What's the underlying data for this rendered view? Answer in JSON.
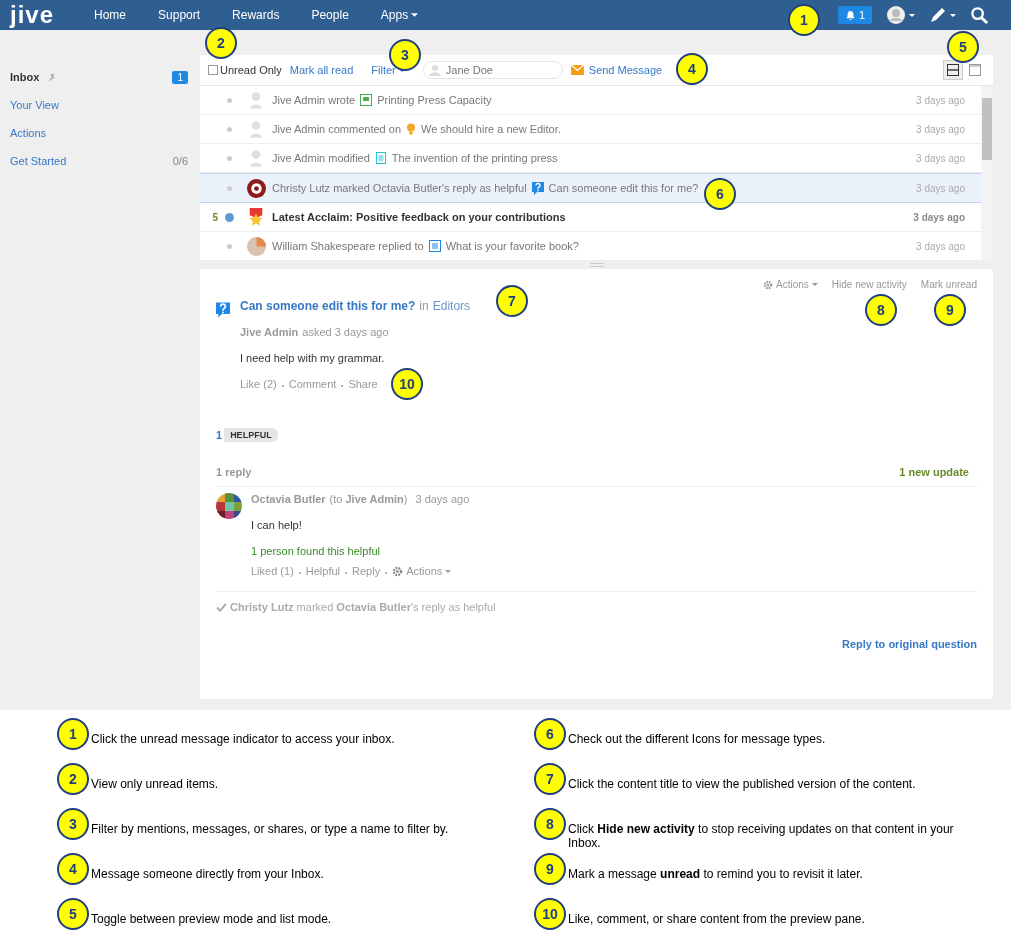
{
  "nav": {
    "logo": "jive",
    "items": [
      "Home",
      "Support",
      "Rewards",
      "People",
      "Apps"
    ],
    "notification_count": "1"
  },
  "sidebar": {
    "items": [
      {
        "label": "Inbox",
        "selected": true,
        "pinned": true,
        "badge": "1"
      },
      {
        "label": "Your View",
        "selected": false
      },
      {
        "label": "Actions",
        "selected": false
      },
      {
        "label": "Get Started",
        "selected": false,
        "count": "0/6"
      }
    ]
  },
  "toolbar": {
    "unread_only": {
      "label": "Unread Only",
      "checked": false
    },
    "mark_all_read": "Mark all read",
    "filter": "Filter",
    "search": {
      "placeholder": "Jane Doe"
    },
    "send_message": "Send Message",
    "view_modes": [
      {
        "kind": "preview",
        "selected": true
      },
      {
        "kind": "list",
        "selected": false
      }
    ]
  },
  "messages": [
    {
      "unread": false,
      "selected": false,
      "avatar": {
        "kind": "silhouette"
      },
      "actor": "Jive Admin wrote",
      "content": {
        "kind": "blog",
        "title": "Printing Press Capacity"
      },
      "time": "3 days ago"
    },
    {
      "unread": false,
      "selected": false,
      "avatar": {
        "kind": "silhouette"
      },
      "actor": "Jive Admin commented on",
      "content": {
        "kind": "idea",
        "title": "We should hire a new Editor."
      },
      "time": "3 days ago"
    },
    {
      "unread": false,
      "selected": false,
      "avatar": {
        "kind": "silhouette"
      },
      "actor": "Jive Admin modified",
      "content": {
        "kind": "document",
        "title": "The invention of the printing press"
      },
      "time": "3 days ago"
    },
    {
      "unread": false,
      "selected": true,
      "avatar": {
        "kind": "target"
      },
      "actor": "Christy Lutz marked Octavia Butler's reply as helpful",
      "content": {
        "kind": "question",
        "title": "Can someone edit this for me?"
      },
      "time": "3 days ago"
    },
    {
      "unread": true,
      "selected": false,
      "count": "5",
      "avatar": {
        "kind": "award"
      },
      "actor": "Latest Acclaim: Positive feedback on your contributions",
      "time": "3 days ago"
    },
    {
      "unread": false,
      "selected": false,
      "avatar": {
        "kind": "photo"
      },
      "actor": "William Shakespeare replied to",
      "content": {
        "kind": "discussion",
        "title": "What is your favorite book?"
      },
      "time": "3 days ago"
    }
  ],
  "preview": {
    "actions": "Actions",
    "hide_new_activity": "Hide new activity",
    "mark_unread": "Mark unread",
    "title": "Can someone edit this for me?",
    "in": "in",
    "place": "Editors",
    "author": "Jive Admin",
    "asked": "asked 3 days ago",
    "body": "I need help with my grammar.",
    "links": [
      "Like (2)",
      "Comment",
      "Share"
    ],
    "helpful": {
      "count": "1",
      "label": "HELPFUL"
    },
    "replies_label": "1 reply",
    "new_update": "1 new update",
    "reply": {
      "author": "Octavia Butler",
      "to": "(to **Jive Admin**)",
      "time": "3 days ago",
      "body": "I can help!",
      "helpful_note": "1 person found this helpful",
      "links": [
        "Liked (1)",
        "Helpful",
        "Reply"
      ],
      "actions": "Actions"
    },
    "marked": "**Christy Lutz** marked **Octavia Butler**'s reply as helpful",
    "reply_original": "Reply to original question"
  },
  "callouts": [
    "1",
    "2",
    "3",
    "4",
    "5",
    "6",
    "7",
    "8",
    "9",
    "10"
  ],
  "annotations": [
    {
      "number": "1",
      "text": "Click the unread message indicator to access your inbox."
    },
    {
      "number": "2",
      "text": "View only unread items."
    },
    {
      "number": "3",
      "text": "Filter by mentions, messages, or shares, or type a name to filter by."
    },
    {
      "number": "4",
      "text": "Message someone directly from your Inbox."
    },
    {
      "number": "5",
      "text": "Toggle between preview mode and list mode."
    },
    {
      "number": "6",
      "text": "Check out the different Icons for message types."
    },
    {
      "number": "7",
      "text": "Click the content title to view the published version of the content."
    },
    {
      "number": "8",
      "text": "Click **Hide new activity** to stop receiving updates on that content in your Inbox."
    },
    {
      "number": "9",
      "text": "Mark a message **unread** to remind you to revisit it later."
    },
    {
      "number": "10",
      "text": "Like, comment, or share content from the preview pane."
    }
  ]
}
